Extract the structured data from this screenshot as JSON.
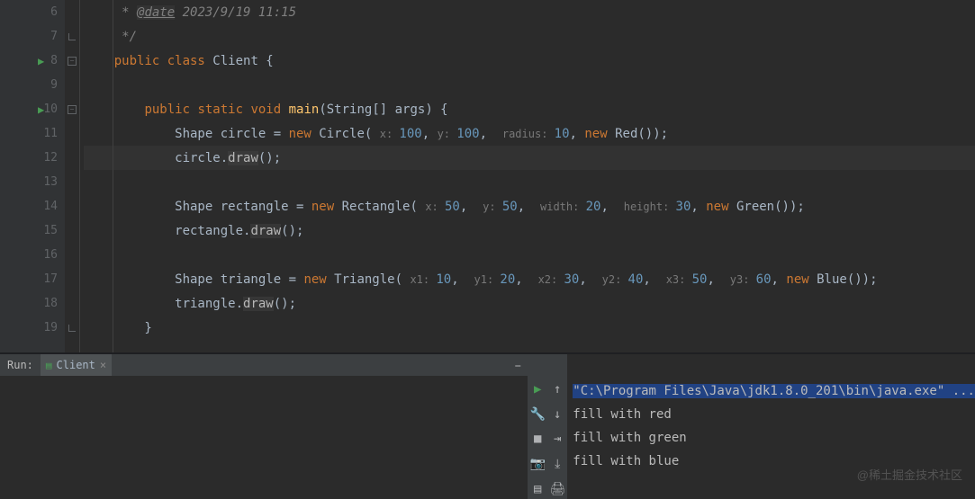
{
  "editor": {
    "lines": [
      {
        "num": "6",
        "play": false,
        "fold": "",
        "tokens": [
          {
            "c": "comment",
            "t": "     * "
          },
          {
            "c": "doc-tag",
            "t": "@date"
          },
          {
            "c": "comment",
            "t": " 2023/9/19 11:15"
          }
        ]
      },
      {
        "num": "7",
        "play": false,
        "fold": "end",
        "tokens": [
          {
            "c": "comment",
            "t": "     */"
          }
        ]
      },
      {
        "num": "8",
        "play": true,
        "fold": "open",
        "tokens": [
          {
            "c": "def",
            "t": "    "
          },
          {
            "c": "kw",
            "t": "public class "
          },
          {
            "c": "def",
            "t": "Client {"
          }
        ]
      },
      {
        "num": "9",
        "play": false,
        "fold": "",
        "tokens": []
      },
      {
        "num": "10",
        "play": true,
        "fold": "open",
        "tokens": [
          {
            "c": "def",
            "t": "        "
          },
          {
            "c": "kw",
            "t": "public static void "
          },
          {
            "c": "method",
            "t": "main"
          },
          {
            "c": "def",
            "t": "(String[] args) {"
          }
        ]
      },
      {
        "num": "11",
        "play": false,
        "fold": "",
        "tokens": [
          {
            "c": "def",
            "t": "            Shape circle = "
          },
          {
            "c": "kw",
            "t": "new "
          },
          {
            "c": "def",
            "t": "Circle( "
          },
          {
            "c": "hint",
            "t": "x: "
          },
          {
            "c": "num",
            "t": "100"
          },
          {
            "c": "def",
            "t": ", "
          },
          {
            "c": "hint",
            "t": "y: "
          },
          {
            "c": "num",
            "t": "100"
          },
          {
            "c": "def",
            "t": ",  "
          },
          {
            "c": "hint",
            "t": "radius: "
          },
          {
            "c": "num",
            "t": "10"
          },
          {
            "c": "def",
            "t": ", "
          },
          {
            "c": "kw",
            "t": "new "
          },
          {
            "c": "def",
            "t": "Red());"
          }
        ]
      },
      {
        "num": "12",
        "play": false,
        "fold": "",
        "current": true,
        "tokens": [
          {
            "c": "def",
            "t": "            circle."
          },
          {
            "c": "new-method",
            "t": "draw"
          },
          {
            "c": "def",
            "t": "();"
          }
        ]
      },
      {
        "num": "13",
        "play": false,
        "fold": "",
        "tokens": []
      },
      {
        "num": "14",
        "play": false,
        "fold": "",
        "tokens": [
          {
            "c": "def",
            "t": "            Shape rectangle = "
          },
          {
            "c": "kw",
            "t": "new "
          },
          {
            "c": "def",
            "t": "Rectangle( "
          },
          {
            "c": "hint",
            "t": "x: "
          },
          {
            "c": "num",
            "t": "50"
          },
          {
            "c": "def",
            "t": ",  "
          },
          {
            "c": "hint",
            "t": "y: "
          },
          {
            "c": "num",
            "t": "50"
          },
          {
            "c": "def",
            "t": ",  "
          },
          {
            "c": "hint",
            "t": "width: "
          },
          {
            "c": "num",
            "t": "20"
          },
          {
            "c": "def",
            "t": ",  "
          },
          {
            "c": "hint",
            "t": "height: "
          },
          {
            "c": "num",
            "t": "30"
          },
          {
            "c": "def",
            "t": ", "
          },
          {
            "c": "kw",
            "t": "new "
          },
          {
            "c": "def",
            "t": "Green());"
          }
        ]
      },
      {
        "num": "15",
        "play": false,
        "fold": "",
        "tokens": [
          {
            "c": "def",
            "t": "            rectangle."
          },
          {
            "c": "new-method",
            "t": "draw"
          },
          {
            "c": "def",
            "t": "();"
          }
        ]
      },
      {
        "num": "16",
        "play": false,
        "fold": "",
        "tokens": []
      },
      {
        "num": "17",
        "play": false,
        "fold": "",
        "tokens": [
          {
            "c": "def",
            "t": "            Shape triangle = "
          },
          {
            "c": "kw",
            "t": "new "
          },
          {
            "c": "def",
            "t": "Triangle( "
          },
          {
            "c": "hint",
            "t": "x1: "
          },
          {
            "c": "num",
            "t": "10"
          },
          {
            "c": "def",
            "t": ",  "
          },
          {
            "c": "hint",
            "t": "y1: "
          },
          {
            "c": "num",
            "t": "20"
          },
          {
            "c": "def",
            "t": ",  "
          },
          {
            "c": "hint",
            "t": "x2: "
          },
          {
            "c": "num",
            "t": "30"
          },
          {
            "c": "def",
            "t": ",  "
          },
          {
            "c": "hint",
            "t": "y2: "
          },
          {
            "c": "num",
            "t": "40"
          },
          {
            "c": "def",
            "t": ",  "
          },
          {
            "c": "hint",
            "t": "x3: "
          },
          {
            "c": "num",
            "t": "50"
          },
          {
            "c": "def",
            "t": ",  "
          },
          {
            "c": "hint",
            "t": "y3: "
          },
          {
            "c": "num",
            "t": "60"
          },
          {
            "c": "def",
            "t": ", "
          },
          {
            "c": "kw",
            "t": "new "
          },
          {
            "c": "def",
            "t": "Blue());"
          }
        ]
      },
      {
        "num": "18",
        "play": false,
        "fold": "",
        "tokens": [
          {
            "c": "def",
            "t": "            triangle."
          },
          {
            "c": "new-method",
            "t": "draw"
          },
          {
            "c": "def",
            "t": "();"
          }
        ]
      },
      {
        "num": "19",
        "play": false,
        "fold": "end",
        "tokens": [
          {
            "c": "def",
            "t": "        }"
          }
        ]
      }
    ]
  },
  "run": {
    "label": "Run:",
    "tab_name": "Client",
    "console": [
      {
        "highlight": true,
        "text": "\"C:\\Program Files\\Java\\jdk1.8.0_201\\bin\\java.exe\" ..."
      },
      {
        "highlight": false,
        "text": "fill with red"
      },
      {
        "highlight": false,
        "text": "fill with green"
      },
      {
        "highlight": false,
        "text": "fill with blue"
      }
    ]
  },
  "watermark": "@稀土掘金技术社区"
}
